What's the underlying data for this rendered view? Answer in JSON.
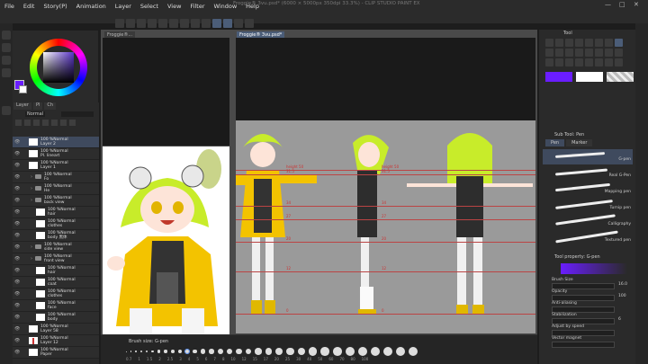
{
  "menu": [
    "File",
    "Edit",
    "Story(P)",
    "Animation",
    "Layer",
    "Select",
    "View",
    "Filter",
    "Window",
    "Help"
  ],
  "window_title": "Froggie® 3vu.psd* (6000 × 5000px 350dpi 33.3%) - CLIP STUDIO PAINT EX",
  "canvas_tabs": {
    "left": "Froggie®...",
    "right": "Froggie® 3vu.psd*"
  },
  "colors": {
    "main": "#6a1dff",
    "sub": "#ffffff",
    "selected_layer": "#3f4a5e",
    "accent_red": "#cc3333"
  },
  "layer_panel": {
    "tabs": [
      "Layer",
      "Pl",
      "Ch"
    ],
    "blend_mode": "Normal",
    "layers": [
      {
        "name": "100 %Normal",
        "sub": "Layer 2",
        "selected": true
      },
      {
        "name": "100 %Normal",
        "sub": "Pl. lineart"
      },
      {
        "name": "100 %Normal",
        "sub": "Layer 1"
      },
      {
        "name": "100 %Normal",
        "sub": "Fo"
      },
      {
        "name": "100 %Normal",
        "sub": "He"
      },
      {
        "name": "100 %Normal",
        "sub": "back view"
      },
      {
        "name": "100 %Normal",
        "sub": "hair"
      },
      {
        "name": "100 %Normal",
        "sub": "clothes"
      },
      {
        "name": "100 %Normal",
        "sub": "body 黒体"
      },
      {
        "name": "100 %Normal",
        "sub": "side view"
      },
      {
        "name": "100 %Normal",
        "sub": "front view"
      },
      {
        "name": "100 %Normal",
        "sub": "hair"
      },
      {
        "name": "100 %Normal",
        "sub": "coat"
      },
      {
        "name": "100 %Normal",
        "sub": "clothes"
      },
      {
        "name": "100 %Normal",
        "sub": "face"
      },
      {
        "name": "100 %Normal",
        "sub": "body"
      },
      {
        "name": "100 %Normal",
        "sub": "Layer 58"
      },
      {
        "name": "100 %Normal",
        "sub": "Layer 12"
      },
      {
        "name": "100 %Normal",
        "sub": "Paper"
      }
    ]
  },
  "timeline": {
    "brush_size_label": "Brush size: G-pen",
    "frames": [
      "0.7",
      "1",
      "1.5",
      "2",
      "2.5",
      "3",
      "4",
      "5",
      "6",
      "7",
      "8",
      "10",
      "12",
      "15",
      "17",
      "20",
      "25",
      "30",
      "40",
      "50",
      "60",
      "70",
      "80",
      "100",
      "120",
      "150",
      "170",
      "200",
      "250",
      "300",
      "400",
      "500"
    ]
  },
  "tool_panel": {
    "title": "Tool",
    "sub_tool_title": "Sub Tool: Pen",
    "sub_tabs": [
      "Pen",
      "Marker"
    ],
    "brushes": [
      "G-pen",
      "Real G-Pen",
      "Mapping pen",
      "Turnip pen",
      "Calligraphy",
      "Textured pen"
    ],
    "property_title": "Tool property: G-pen",
    "props": [
      {
        "label": "Brush Size",
        "value": "16.0"
      },
      {
        "label": "Opacity",
        "value": "100"
      },
      {
        "label": "Anti-aliasing",
        "value": ""
      },
      {
        "label": "Stabilization",
        "value": "6"
      },
      {
        "label": "Adjust by speed",
        "value": ""
      },
      {
        "label": "Vector magnet",
        "value": ""
      }
    ]
  },
  "sheet_labels": [
    "height 50",
    "31.5",
    "34",
    "27",
    "20",
    "12",
    "0"
  ]
}
